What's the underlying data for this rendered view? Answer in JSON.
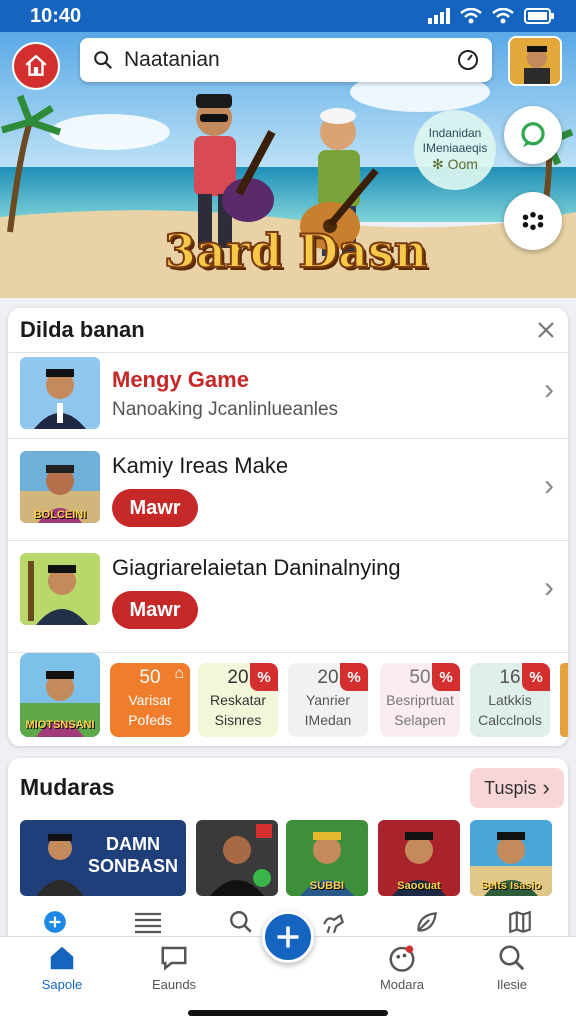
{
  "status": {
    "time": "10:40"
  },
  "header": {
    "search_query": "Naatanian",
    "home_icon": "home-icon",
    "search_icon": "search-icon",
    "refresh_icon": "refresh-icon"
  },
  "hero": {
    "title": "3ard Dasn",
    "promo_line1": "Indanidan",
    "promo_line2": "IMeniaaeqis",
    "promo_line3": "✻ Oom"
  },
  "card1": {
    "title": "Dilda banan",
    "rows": [
      {
        "title": "Mengy Game",
        "subtitle": "Nanoaking Jcanlinlueanles",
        "title_color": "#c62828"
      },
      {
        "title": "Kamiy Ireas Make",
        "button": "Mawr"
      },
      {
        "title": "Giagriarelaietan Daninalnying",
        "button": "Mawr"
      }
    ],
    "thumb_captions": [
      "",
      "BOLCEINI",
      ""
    ],
    "tiles": [
      {
        "num": "50",
        "l1": "Varisar",
        "l2": "Pofeds",
        "bg": "#ef7d2c",
        "fg": "#ffffff"
      },
      {
        "num": "20",
        "l1": "Reskatar",
        "l2": "Sisnres",
        "bg": "#f3f6d8",
        "fg": "#333333"
      },
      {
        "num": "20",
        "l1": "Yanrier",
        "l2": "IMedan",
        "bg": "#f1f1f1",
        "fg": "#555555"
      },
      {
        "num": "50",
        "l1": "Besriprtuat",
        "l2": "Selapen",
        "bg": "#fbecef",
        "fg": "#777777"
      },
      {
        "num": "16",
        "l1": "Latkkis",
        "l2": "Calcclnols",
        "bg": "#dff0ec",
        "fg": "#555555"
      }
    ],
    "tile_badge": "%",
    "first_tile_caption": "MIOTSNSANI"
  },
  "card2": {
    "title": "Mudaras",
    "more_label": "Tuspis",
    "thumbs": [
      {
        "caption": "DAMN SONBASN"
      },
      {
        "caption": ""
      },
      {
        "caption": "SUBBI"
      },
      {
        "caption": "Saoouat"
      },
      {
        "caption": "Selts Isasio"
      }
    ]
  },
  "bottom_nav": {
    "items": [
      {
        "label": "Sapole",
        "icon": "home-icon"
      },
      {
        "label": "Eaunds",
        "icon": "chat-icon"
      },
      {
        "label": "Modara",
        "icon": "palette-icon"
      },
      {
        "label": "Ilesie",
        "icon": "search-icon"
      }
    ],
    "center_icon": "plus-icon"
  },
  "colors": {
    "primary": "#1565c0",
    "danger": "#c62828"
  }
}
